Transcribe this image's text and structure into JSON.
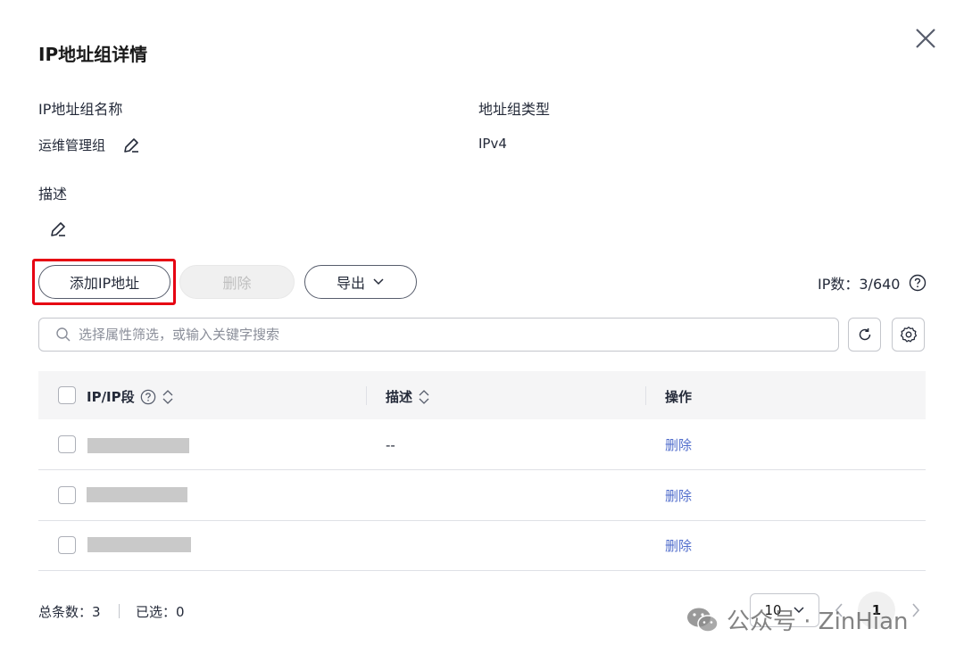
{
  "dialog": {
    "title": "IP地址组详情",
    "fields": {
      "name_label": "IP地址组名称",
      "name_value": "运维管理组",
      "type_label": "地址组类型",
      "type_value": "IPv4",
      "desc_label": "描述"
    }
  },
  "toolbar": {
    "add_label": "添加IP地址",
    "delete_label": "删除",
    "export_label": "导出",
    "ip_count_label": "IP数：3/640"
  },
  "search": {
    "placeholder": "选择属性筛选，或输入关键字搜索"
  },
  "table": {
    "columns": [
      "IP/IP段",
      "描述",
      "操作"
    ],
    "rows": [
      {
        "ip": "",
        "desc": "--",
        "action": "删除"
      },
      {
        "ip": "",
        "desc": "",
        "action": "删除"
      },
      {
        "ip": "",
        "desc": "",
        "action": "删除"
      }
    ]
  },
  "footer": {
    "total": "总条数：3",
    "selected": "已选：0",
    "page_size": "10",
    "current_page": "1"
  },
  "watermark": {
    "text": "公众号 · ZinHian"
  },
  "colors": {
    "highlight": "#e60012",
    "link": "#526ecc",
    "header_bg": "#f5f5f6"
  }
}
